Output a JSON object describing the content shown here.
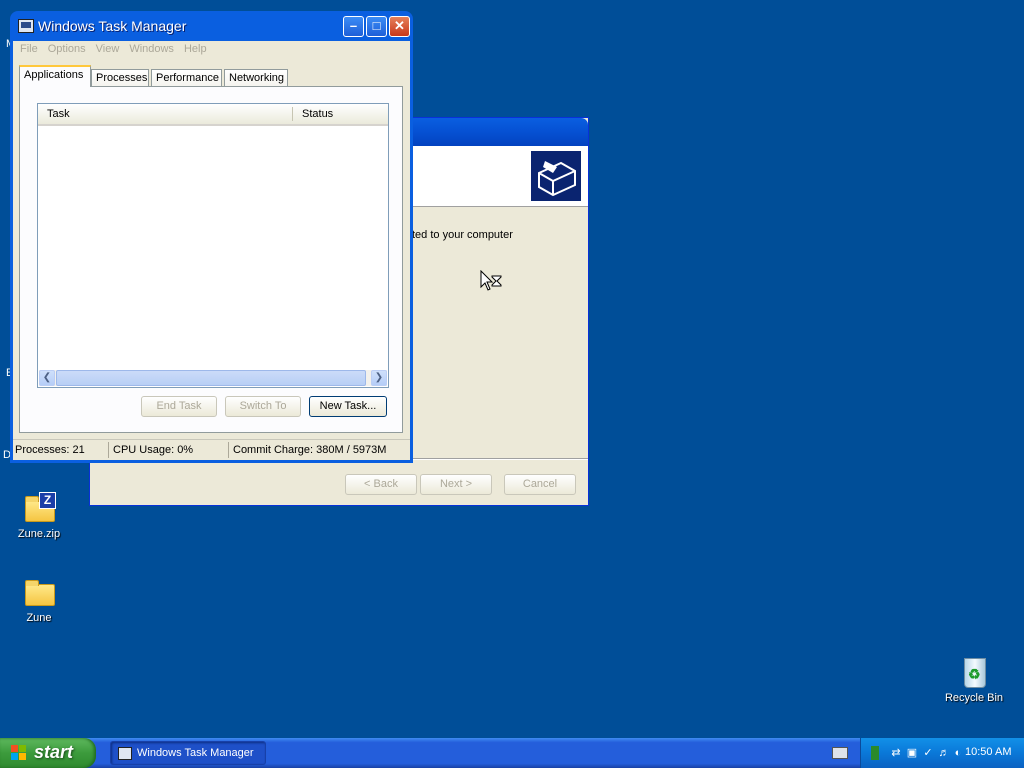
{
  "desktop": {
    "icons": [
      {
        "label": "Zune.zip",
        "badge": "Z"
      },
      {
        "label": "Zune"
      },
      {
        "label": "Recycle Bin"
      }
    ],
    "edge_letters": [
      "M",
      "E",
      "D"
    ]
  },
  "wizard": {
    "body_text": "ted to your computer",
    "buttons": {
      "back": "< Back",
      "next": "Next >",
      "cancel": "Cancel"
    }
  },
  "task_manager": {
    "title": "Windows Task Manager",
    "menu": [
      "File",
      "Options",
      "View",
      "Windows",
      "Help"
    ],
    "tabs": [
      "Applications",
      "Processes",
      "Performance",
      "Networking"
    ],
    "active_tab": "Applications",
    "columns": {
      "task": "Task",
      "status": "Status"
    },
    "buttons": {
      "end_task": "End Task",
      "switch_to": "Switch To",
      "new_task": "New Task..."
    },
    "status": {
      "processes": "Processes: 21",
      "cpu": "CPU Usage: 0%",
      "commit": "Commit Charge: 380M / 5973M"
    }
  },
  "taskbar": {
    "start_label": "start",
    "items": [
      {
        "label": "Windows Task Manager"
      }
    ],
    "clock": "10:50 AM"
  },
  "colors": {
    "desktop": "#004e98",
    "titlebar": "#0a5fe0",
    "taskbar": "#245edb",
    "start": "#3c9b3c",
    "tray": "#0a78d8"
  }
}
